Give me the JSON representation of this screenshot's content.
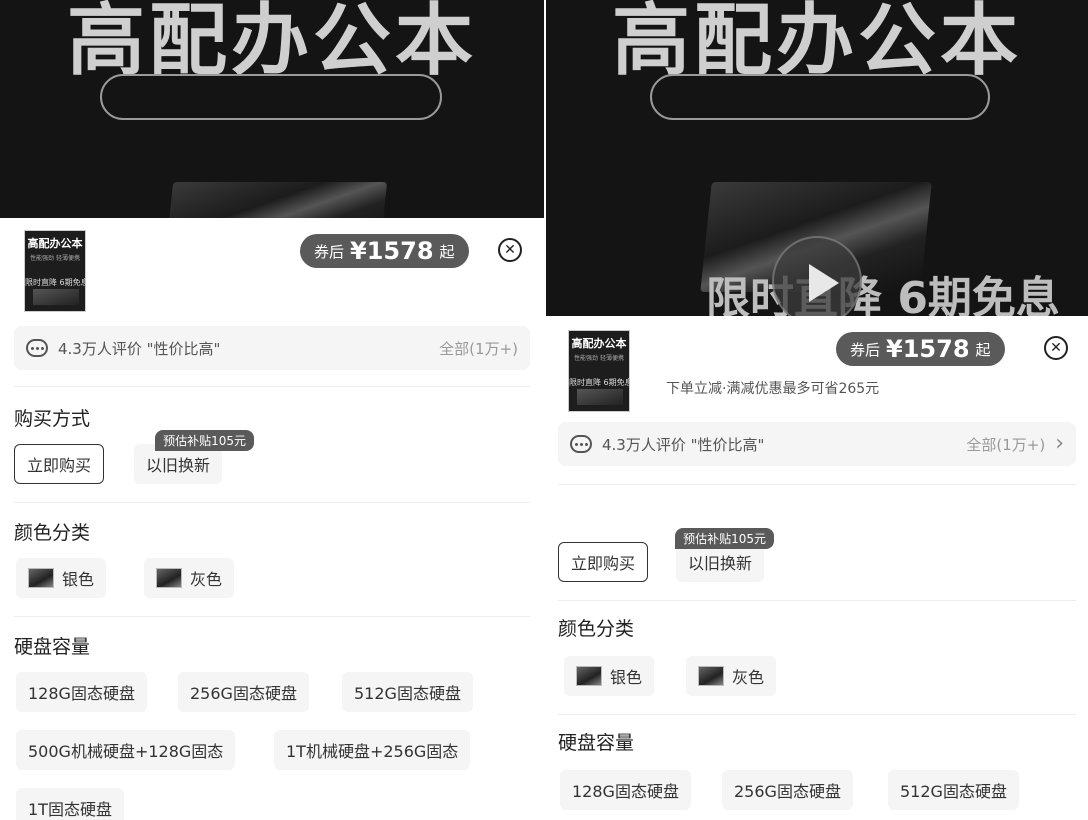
{
  "banner": {
    "title": "高配办公本",
    "subtitle": "限时直降 6期免息"
  },
  "thumb": {
    "title": "高配办公本",
    "tagline": "性能强劲 轻薄便携",
    "promo": "限时直降 6期免息"
  },
  "left": {
    "price_label": "券后",
    "price_value": "¥1578",
    "price_suffix": "起",
    "reviews_text": "4.3万人评价 \"性价比高\"",
    "reviews_all": "全部(1万+)",
    "purchase": {
      "title": "购买方式",
      "options": [
        "立即购买",
        "以旧换新"
      ],
      "badge": "预估补贴105元"
    },
    "color": {
      "title": "颜色分类",
      "options": [
        "银色",
        "灰色"
      ]
    },
    "storage": {
      "title": "硬盘容量",
      "options": [
        "128G固态硬盘",
        "256G固态硬盘",
        "512G固态硬盘",
        "500G机械硬盘+128G固态",
        "1T机械硬盘+256G固态",
        "1T固态硬盘"
      ]
    }
  },
  "right": {
    "price_label": "券后",
    "price_value": "¥1578",
    "price_suffix": "起",
    "coupon_text": "下单立减·满减优惠最多可省265元",
    "reviews_text": "4.3万人评价 \"性价比高\"",
    "reviews_all": "全部(1万+)",
    "purchase": {
      "options": [
        "立即购买",
        "以旧换新"
      ],
      "badge": "预估补贴105元"
    },
    "color": {
      "title": "颜色分类",
      "options": [
        "银色",
        "灰色"
      ]
    },
    "storage": {
      "title": "硬盘容量",
      "options": [
        "128G固态硬盘",
        "256G固态硬盘",
        "512G固态硬盘"
      ]
    }
  },
  "icons": {
    "close": "close-circle-icon",
    "chat": "chat-bubble-icon",
    "chevron": "chevron-right-icon",
    "play": "play-icon"
  }
}
